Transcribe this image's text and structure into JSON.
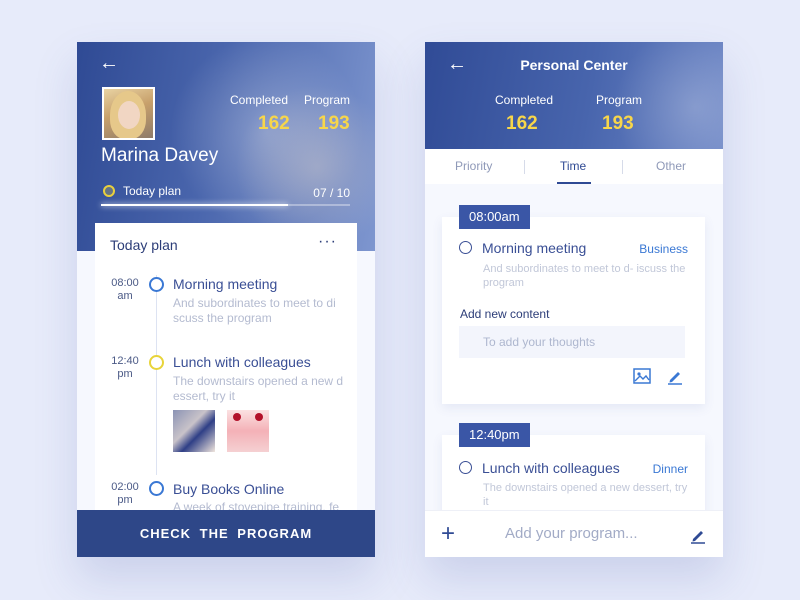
{
  "profile_screen": {
    "user_name": "Marina Davey",
    "stats": [
      {
        "label": "Completed",
        "value": "162"
      },
      {
        "label": "Program",
        "value": "193"
      }
    ],
    "today_plan": {
      "label": "Today plan",
      "count": "07 / 10",
      "progress": 0.75
    },
    "card_title": "Today plan",
    "more": "···",
    "timeline": [
      {
        "time_top": "08:00",
        "time_bottom": "am",
        "title": "Morning meeting",
        "desc": "And subordinates to meet to di scuss the program"
      },
      {
        "time_top": "12:40",
        "time_bottom": "pm",
        "title": "Lunch with colleagues",
        "desc": "The downstairs opened a new d essert, try it"
      },
      {
        "time_top": "02:00",
        "time_bottom": "pm",
        "title": "Buy Books Online",
        "desc": "A week of stovepipe training, fe"
      }
    ],
    "cta": "CHECK THE PROGRAM"
  },
  "personal_center": {
    "title": "Personal Center",
    "stats": [
      {
        "label": "Completed",
        "value": "162"
      },
      {
        "label": "Program",
        "value": "193"
      }
    ],
    "tabs": [
      {
        "label": "Priority"
      },
      {
        "label": "Time"
      },
      {
        "label": "Other"
      }
    ],
    "entries": [
      {
        "time": "08:00am",
        "title": "Morning meeting",
        "tag": "Business",
        "desc": "And subordinates to meet to d- iscuss the program"
      },
      {
        "time": "12:40pm",
        "title": "Lunch with colleagues",
        "tag": "Dinner",
        "desc": "The downstairs opened a new dessert, try it"
      }
    ],
    "add_content": {
      "label": "Add new content",
      "placeholder": "To add your thoughts"
    },
    "footer": {
      "placeholder": "Add your program..."
    }
  },
  "colors": {
    "primary": "#2e4788",
    "accent_yellow": "#f7d64a",
    "link_blue": "#3a78d4"
  }
}
